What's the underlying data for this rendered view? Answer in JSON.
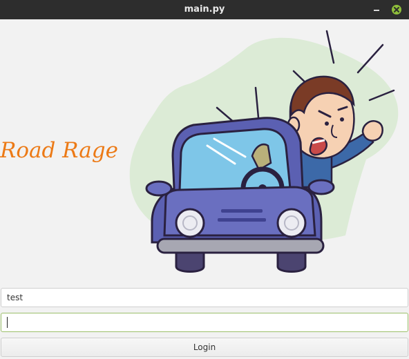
{
  "window": {
    "title": "main.py"
  },
  "app": {
    "title": "Road Rage",
    "title_color": "#ec7a16"
  },
  "illustration": {
    "icon": "angry-driver-car-illustration"
  },
  "form": {
    "username_value": "test",
    "password_value": "",
    "login_label": "Login"
  },
  "colors": {
    "titlebar": "#2d2d2d",
    "close_button": "#8fbf3a",
    "focus_border": "#9bbf6a",
    "car_body": "#5b60b2"
  }
}
